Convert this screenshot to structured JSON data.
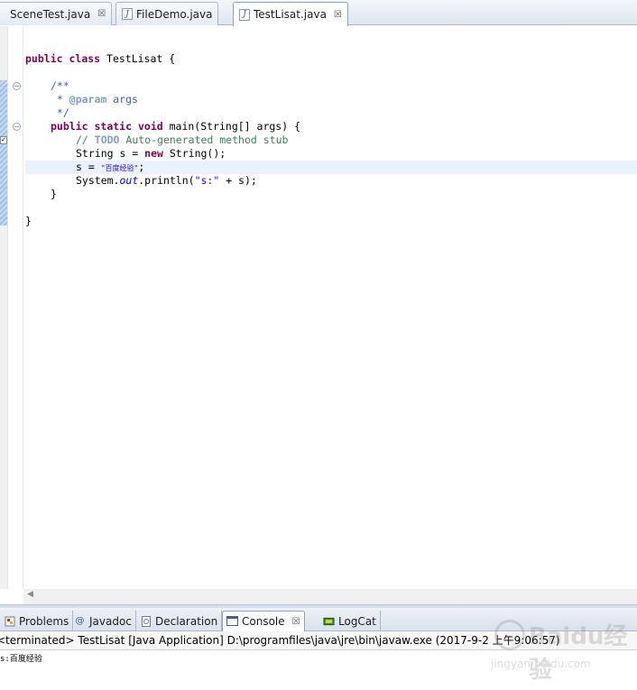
{
  "editor_tabs": [
    {
      "label": "SceneTest.java",
      "icon": "java-file-icon",
      "close": "☒",
      "active": false
    },
    {
      "label": "FileDemo.java",
      "icon": "java-file-icon",
      "close": "",
      "active": false
    },
    {
      "label": "TestLisat.java",
      "icon": "java-file-icon",
      "close": "☒",
      "active": true
    }
  ],
  "code": {
    "class_decl": {
      "kw1": "public",
      "kw2": "class",
      "name": " TestLisat {"
    },
    "jd_open": "/**",
    "jd_param_star": " * ",
    "jd_param_tag": "@param",
    "jd_param_name": " args",
    "jd_close": " */",
    "main_decl": {
      "kw1": "public",
      "kw2": "static",
      "kw3": "void",
      "rest": " main(String[] args) {"
    },
    "todo_prefix": "// ",
    "todo_tag": "TODO",
    "todo_rest": " Auto-generated method stub",
    "line_string_decl": {
      "pre": "String s = ",
      "kw": "new",
      "post": " String();"
    },
    "line_assign": {
      "pre": "s = ",
      "str": "\"百度经验\"",
      "post": ";"
    },
    "line_print": {
      "pre": "System.",
      "field": "out",
      "mid": ".println(",
      "str": "\"s:\"",
      "post": " + s);"
    },
    "close_method": "}",
    "close_class": "}"
  },
  "panel_tabs": [
    {
      "label": "Problems",
      "icon": "problems-icon",
      "active": false
    },
    {
      "label": "Javadoc",
      "icon": "at-sign-icon",
      "active": false
    },
    {
      "label": "Declaration",
      "icon": "declaration-icon",
      "active": false
    },
    {
      "label": "Console",
      "icon": "console-icon",
      "close": "☒",
      "active": true
    },
    {
      "label": "LogCat",
      "icon": "logcat-icon",
      "active": false
    }
  ],
  "console": {
    "status": "<terminated> TestLisat [Java Application] D:\\programfiles\\java\\jre\\bin\\javaw.exe (2017-9-2 上午9:06:57)",
    "output": "s:百度经验"
  },
  "watermark": {
    "brand": "Baidu经验",
    "url": "jingyan.baidu.com"
  }
}
